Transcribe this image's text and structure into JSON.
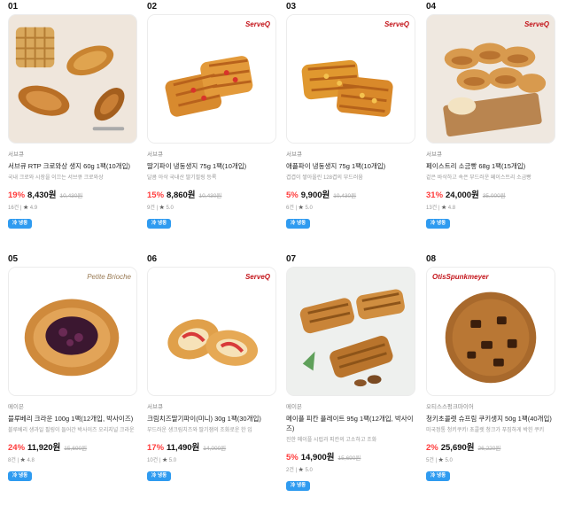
{
  "products": [
    {
      "rank": "01",
      "brand": "",
      "seller": "서브큐",
      "title": "서브큐 RTP 크로와상 생지 60g 1팩(10개입)",
      "desc": "국내 크로와 시장을 이끄는 서브큐 크로와상",
      "discount": "19%",
      "price": "8,430원",
      "orig": "10,430원",
      "count": "16건",
      "rating": "4.9",
      "tag": "冷 냉동"
    },
    {
      "rank": "02",
      "brand": "ServeQ",
      "seller": "서브큐",
      "title": "딸기파이 냉동생지 75g 1팩(10개입)",
      "desc": "달콤 아삭 국내산 딸기필링 등록",
      "discount": "15%",
      "price": "8,860원",
      "orig": "10,430원",
      "count": "9건",
      "rating": "5.0",
      "tag": "冷 냉동"
    },
    {
      "rank": "03",
      "brand": "ServeQ",
      "seller": "서브큐",
      "title": "애플파이 냉동생지 75g 1팩(10개입)",
      "desc": "겹겹이 쌓아올린 128겹의 부드러움",
      "discount": "5%",
      "price": "9,900원",
      "orig": "10,430원",
      "count": "6건",
      "rating": "5.0",
      "tag": "冷 냉동"
    },
    {
      "rank": "04",
      "brand": "ServeQ",
      "seller": "서브큐",
      "title": "페이스트리 소금빵 68g 1팩(15개입)",
      "desc": "겉은 바삭하고 속은 부드러운 페이스트리 소금빵",
      "discount": "31%",
      "price": "24,000원",
      "orig": "35,000원",
      "count": "13건",
      "rating": "4.8",
      "tag": "冷 냉동"
    },
    {
      "rank": "05",
      "brand": "Petite Brioche",
      "seller": "메이븐",
      "title": "블루베리 크라운 100g 1팩(12개입, 박사이즈)",
      "desc": "블루베리 생과일 필링이 들어간 박사이즈 오리지널 크라운",
      "discount": "24%",
      "price": "11,920원",
      "orig": "15,690원",
      "count": "8건",
      "rating": "4.8",
      "tag": "冷 냉동"
    },
    {
      "rank": "06",
      "brand": "ServeQ",
      "seller": "서브큐",
      "title": "크림치즈딸기파이(미니) 30g 1팩(30개입)",
      "desc": "부드러운 생크림치즈와 딸기잼의 조화로운 한 입",
      "discount": "17%",
      "price": "11,490원",
      "orig": "14,000원",
      "count": "10건",
      "rating": "5.0",
      "tag": "冷 냉동"
    },
    {
      "rank": "07",
      "brand": "",
      "seller": "메이븐",
      "title": "메이플 피칸 플레이트 95g 1팩(12개입, 박사이즈)",
      "desc": "진한 메이플 시럽과 피칸의 고소하고 조화",
      "discount": "5%",
      "price": "14,900원",
      "orig": "15,690원",
      "count": "2건",
      "rating": "5.0",
      "tag": "冷 냉동"
    },
    {
      "rank": "08",
      "brand": "OtisSpunkmeyer",
      "seller": "오티스스펑크마이어",
      "title": "청키초콜렛 슈프림 쿠키생지 50g 1팩(40개입)",
      "desc": "미국정통 청키쿠키! 초콜렛 청크가 푸짐하게 박힌 쿠키",
      "discount": "2%",
      "price": "25,690원",
      "orig": "26,220원",
      "count": "5건",
      "rating": "5.0",
      "tag": "冷 냉동"
    }
  ]
}
